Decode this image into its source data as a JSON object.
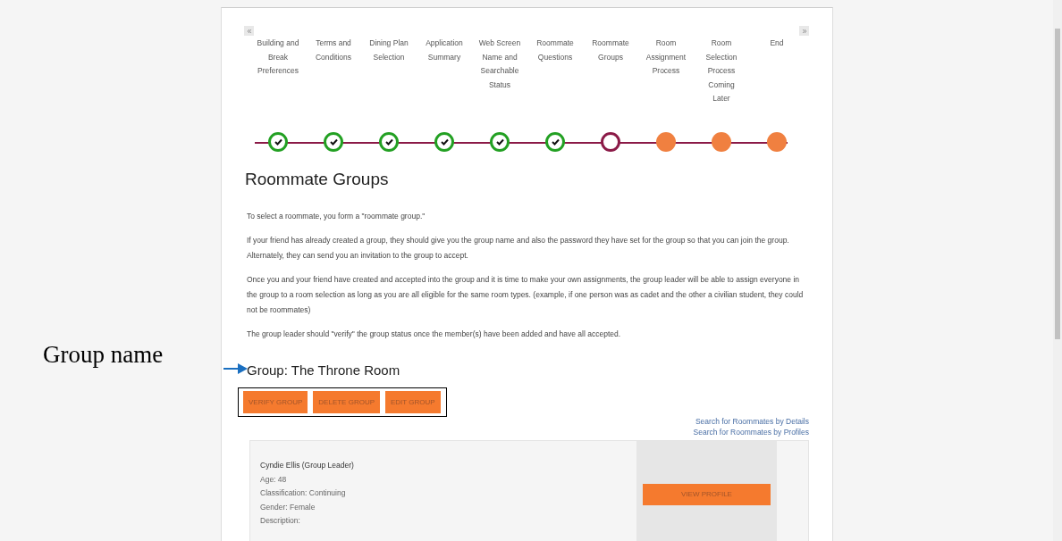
{
  "annotation": {
    "label": "Group name"
  },
  "steps": [
    {
      "label": "Building and Break Preferences",
      "kind": "done"
    },
    {
      "label": "Terms and Conditions",
      "kind": "done"
    },
    {
      "label": "Dining Plan Selection",
      "kind": "done"
    },
    {
      "label": "Application Summary",
      "kind": "done"
    },
    {
      "label": "Web Screen Name and Searchable Status",
      "kind": "done"
    },
    {
      "label": "Roommate Questions",
      "kind": "done"
    },
    {
      "label": "Roommate Groups",
      "kind": "current"
    },
    {
      "label": "Room Assignment Process",
      "kind": "upcoming"
    },
    {
      "label": "Room Selection Process Coming Later",
      "kind": "upcoming"
    },
    {
      "label": "End",
      "kind": "upcoming"
    }
  ],
  "heading": "Roommate Groups",
  "paragraphs": [
    "To select a roommate, you form a \"roommate group.\"",
    "If your friend has already created a group, they should give you the group name and also the password they have set for the group so that you can join the group. Alternately, they can send you an invitation to the group to accept.",
    "Once you and your friend have created and accepted into the group and it is time to make your own assignments, the group leader will be able to assign everyone in the group to a room selection as long as you are all eligible for the same room types. (example, if one person was as cadet and the other a civilian student, they could not be roommates)",
    "The group leader should \"verify\" the group status once the member(s) have been added and have all accepted."
  ],
  "group_title": "Group: The Throne Room",
  "group_buttons": [
    "VERIFY GROUP",
    "DELETE GROUP",
    "EDIT GROUP"
  ],
  "search_links": [
    "Search for Roommates by Details",
    "Search for Roommates by Profiles"
  ],
  "members": [
    {
      "name": "Cyndie Ellis (Group Leader)",
      "details": [
        "Age: 48",
        "Classification: Continuing",
        "Gender: Female",
        "Description:"
      ],
      "button": "VIEW PROFILE"
    }
  ]
}
